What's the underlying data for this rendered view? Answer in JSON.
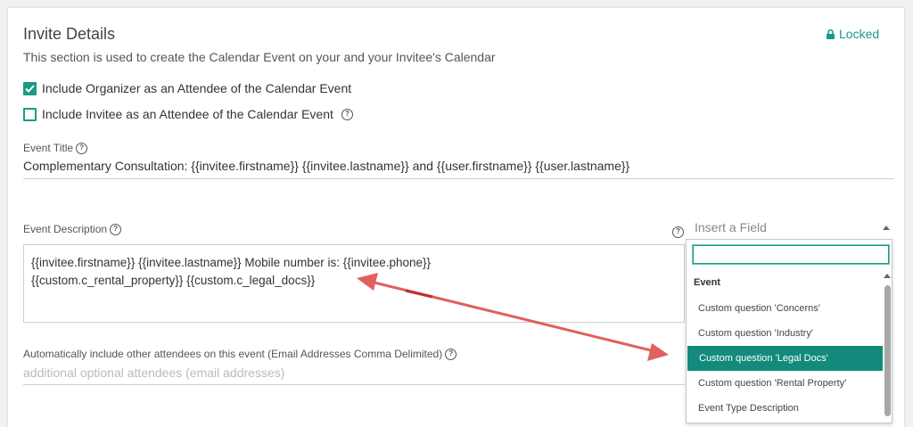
{
  "section": {
    "title": "Invite Details",
    "subtitle": "This section is used to create the Calendar Event on your and your Invitee's Calendar",
    "locked_label": "Locked"
  },
  "checkboxes": [
    {
      "label": "Include Organizer as an Attendee of the Calendar Event",
      "checked": true
    },
    {
      "label": "Include Invitee as an Attendee of the Calendar Event",
      "checked": false
    }
  ],
  "event_title": {
    "label": "Event Title",
    "value": "Complementary Consultation: {{invitee.firstname}} {{invitee.lastname}} and {{user.firstname}} {{user.lastname}}"
  },
  "event_description": {
    "label": "Event Description",
    "line1": "{{invitee.firstname}} {{invitee.lastname}} Mobile number is: {{invitee.phone}}",
    "line2": "{{custom.c_rental_property}} {{custom.c_legal_docs}}"
  },
  "insert_field": {
    "placeholder": "Insert a Field",
    "search_value": "",
    "group": "Event",
    "options": [
      "Custom question 'Concerns'",
      "Custom question 'Industry'",
      "Custom question 'Legal Docs'",
      "Custom question 'Rental Property'",
      "Event Type Description"
    ],
    "selected_index": 2
  },
  "attendees": {
    "label": "Automatically include other attendees on this event (Email Addresses Comma Delimited)",
    "placeholder": "additional optional attendees (email addresses)"
  },
  "colors": {
    "accent": "#1a9a86",
    "selected_bg": "#138a7b",
    "annotation_arrow": "#e06060"
  },
  "icons": [
    "lock-icon",
    "checkmark-icon",
    "help-icon",
    "caret-up-icon",
    "scroll-up-icon"
  ]
}
